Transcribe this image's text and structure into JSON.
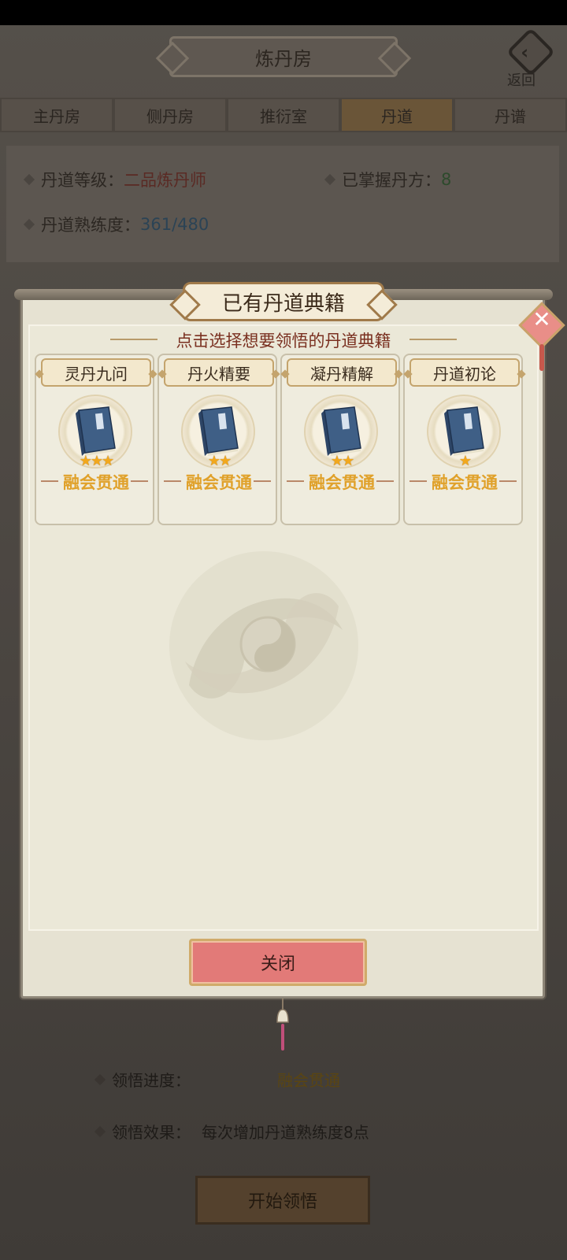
{
  "screen": {
    "title": "炼丹房",
    "back_label": "返回",
    "tabs": [
      {
        "label": "主丹房"
      },
      {
        "label": "侧丹房"
      },
      {
        "label": "推衍室"
      },
      {
        "label": "丹道"
      },
      {
        "label": "丹谱"
      }
    ],
    "info": {
      "level_label": "丹道等级：",
      "level_value": "二品炼丹师",
      "mastered_label": "已掌握丹方：",
      "mastered_value": "8",
      "proficiency_label": "丹道熟练度：",
      "proficiency_value": "361/480"
    },
    "comprehension": {
      "progress_label": "领悟进度：",
      "progress_value": "融会贯通",
      "effect_label": "领悟效果：",
      "effect_value": "每次增加丹道熟练度8点",
      "start_label": "开始领悟"
    }
  },
  "modal": {
    "title": "已有丹道典籍",
    "subtitle": "点击选择想要领悟的丹道典籍",
    "books": [
      {
        "name": "灵丹九问",
        "stars": 3,
        "star_text": "★★★",
        "mastery": "融会贯通"
      },
      {
        "name": "丹火精要",
        "stars": 2,
        "star_text": "★★",
        "mastery": "融会贯通"
      },
      {
        "name": "凝丹精解",
        "stars": 2,
        "star_text": "★★",
        "mastery": "融会贯通"
      },
      {
        "name": "丹道初论",
        "stars": 1,
        "star_text": "★",
        "mastery": "融会贯通"
      }
    ],
    "close_label": "关闭"
  },
  "colors": {
    "accent_gold": "#e0a12a",
    "star": "#f2a81d",
    "close_button": "#e27a78",
    "subtitle_red": "#7a3020"
  }
}
